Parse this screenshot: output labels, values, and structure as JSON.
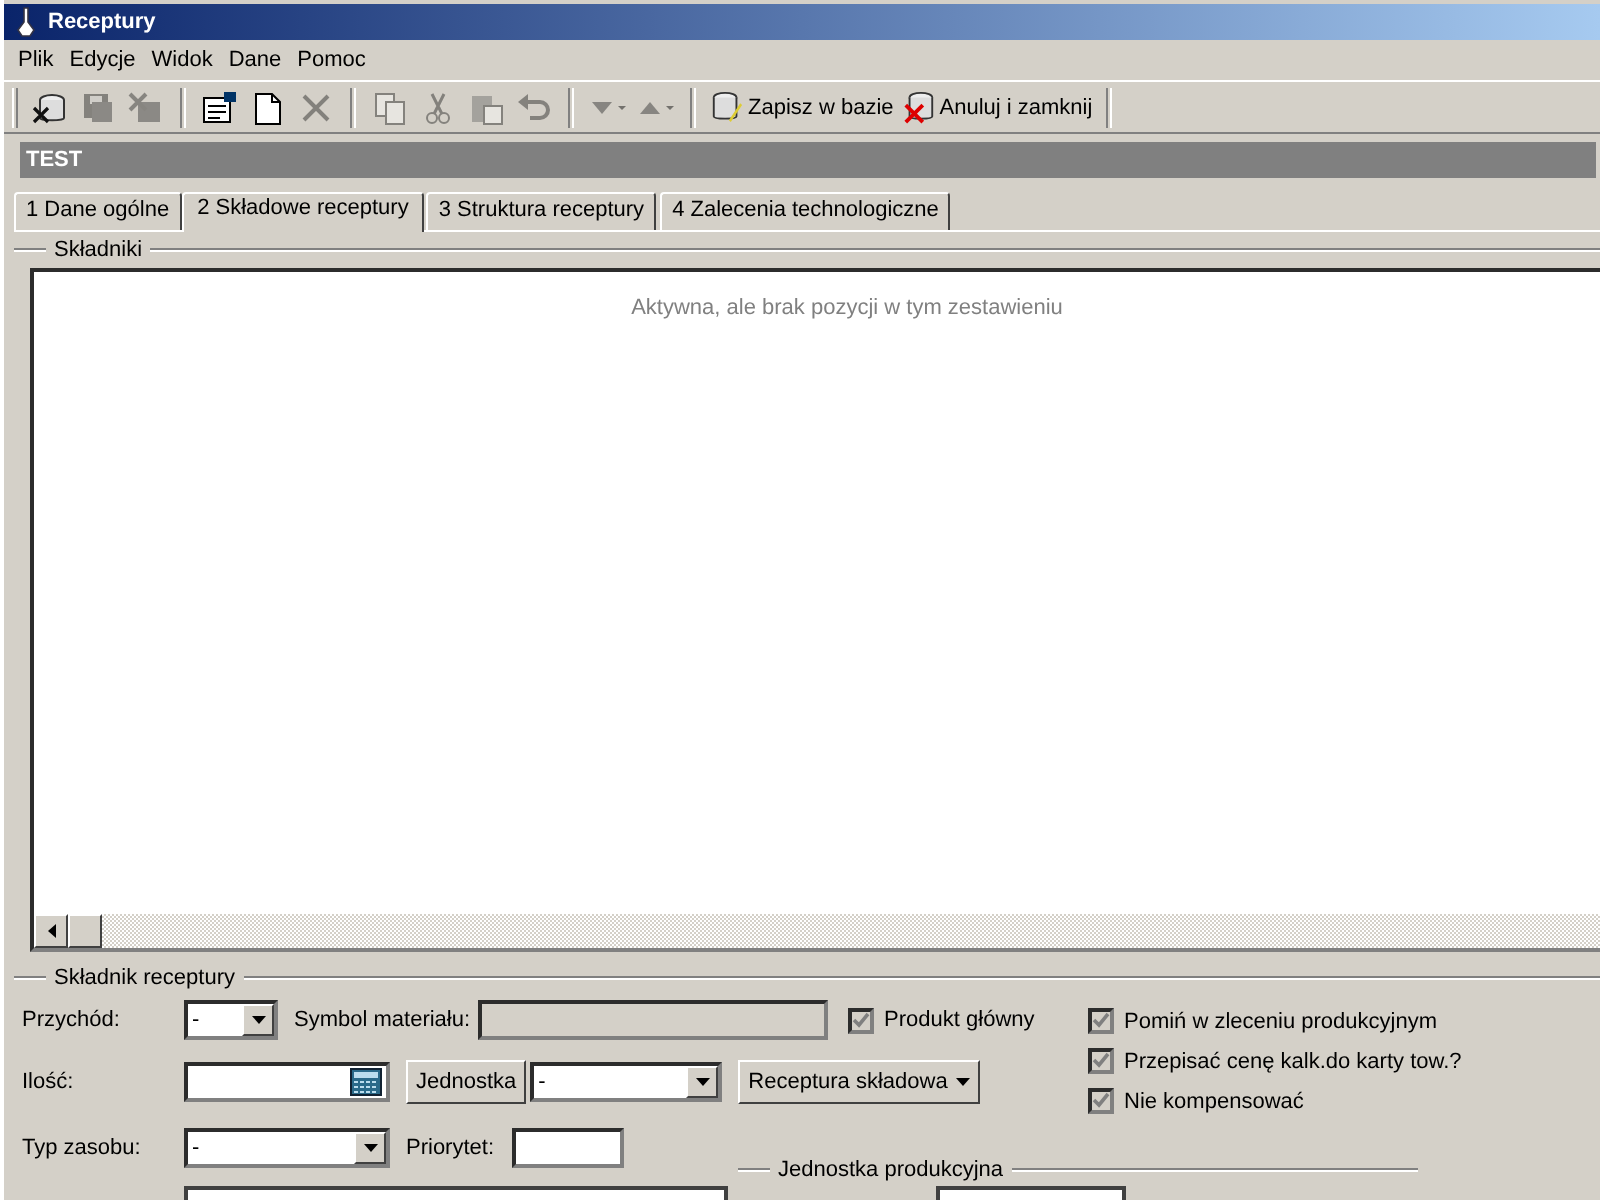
{
  "window": {
    "title": "Receptury"
  },
  "menu": [
    "Plik",
    "Edycje",
    "Widok",
    "Dane",
    "Pomoc"
  ],
  "toolbar": [
    {
      "kind": "cancel_db",
      "disabled": false
    },
    {
      "kind": "save",
      "disabled": true
    },
    {
      "kind": "save_close",
      "disabled": true
    },
    {
      "kind": "separator"
    },
    {
      "kind": "properties",
      "disabled": false
    },
    {
      "kind": "new",
      "disabled": false
    },
    {
      "kind": "delete",
      "disabled": true
    },
    {
      "kind": "separator"
    },
    {
      "kind": "copy",
      "disabled": true
    },
    {
      "kind": "cut",
      "disabled": true
    },
    {
      "kind": "paste",
      "disabled": true
    },
    {
      "kind": "undo",
      "disabled": true
    },
    {
      "kind": "separator"
    },
    {
      "kind": "down",
      "disabled": true
    },
    {
      "kind": "up",
      "disabled": true
    },
    {
      "kind": "separator"
    },
    {
      "kind": "save_text",
      "label": "Zapisz w bazie",
      "disabled": false
    },
    {
      "kind": "cancel_text",
      "label": "Anuluj i zamknij",
      "disabled": false
    },
    {
      "kind": "separator"
    }
  ],
  "header": "TEST",
  "tabs": [
    {
      "label": "1 Dane ogólne",
      "selected": false
    },
    {
      "label": "2 Składowe receptury",
      "selected": true
    },
    {
      "label": "3 Struktura receptury",
      "selected": false
    },
    {
      "label": "4 Zalecenia technologiczne",
      "selected": false
    }
  ],
  "components": {
    "legend": "Składniki",
    "empty_message": "Aktywna, ale brak pozycji w tym zestawieniu"
  },
  "ingredient": {
    "legend": "Składnik receptury",
    "income": {
      "label": "Przychód:",
      "value": "-"
    },
    "material_symbol": {
      "label": "Symbol materiału:"
    },
    "quantity": {
      "label": "Ilość:"
    },
    "unit_button": "Jednostka",
    "unit": {
      "value": "-"
    },
    "recipe_button": "Receptura składowa",
    "resource_type": {
      "label": "Typ zasobu:",
      "value": "-"
    },
    "priority": {
      "label": "Priorytet:"
    },
    "production_unit": {
      "legend": "Jednostka produkcyjna"
    },
    "checkboxes": [
      {
        "label": "Produkt główny",
        "checked": true,
        "disabled": true
      },
      {
        "label": "Pomiń w zleceniu produkcyjnym",
        "checked": true,
        "disabled": true
      },
      {
        "label": "Przepisać cenę kalk.do karty tow.?",
        "checked": true,
        "disabled": true
      },
      {
        "label": "Nie kompensować",
        "checked": true,
        "disabled": true
      }
    ]
  }
}
